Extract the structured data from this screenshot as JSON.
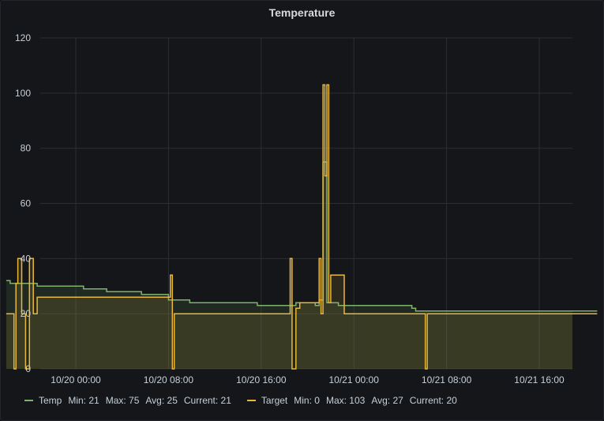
{
  "panel": {
    "title": "Temperature"
  },
  "colors": {
    "temp": "#7eb26d",
    "target": "#eab839",
    "grid": "#2c2e33",
    "text": "#c7d0d9",
    "background": "#141619"
  },
  "legend": [
    {
      "name": "Temp",
      "color_key": "temp",
      "stats": [
        "Min: 21",
        "Max: 75",
        "Avg: 25",
        "Current: 21"
      ]
    },
    {
      "name": "Target",
      "color_key": "target",
      "stats": [
        "Min: 0",
        "Max: 103",
        "Avg: 27",
        "Current: 20"
      ]
    }
  ],
  "chart_data": {
    "type": "area",
    "title": "Temperature",
    "xlabel": "",
    "ylabel": "",
    "ylim": [
      0,
      120
    ],
    "yticks": [
      0,
      20,
      40,
      60,
      80,
      100,
      120
    ],
    "xlim": [
      "10/19 18:00",
      "10/21 21:00"
    ],
    "xticks": [
      "10/20 00:00",
      "10/20 08:00",
      "10/20 16:00",
      "10/21 00:00",
      "10/21 08:00",
      "10/21 16:00"
    ],
    "grid": true,
    "legend_position": "bottom-left",
    "series": [
      {
        "name": "Temp",
        "color": "#7eb26d",
        "fill": true,
        "points": [
          [
            "10/19 18:00",
            32
          ],
          [
            "10/19 18:20",
            31
          ],
          [
            "10/19 19:00",
            31
          ],
          [
            "10/19 20:40",
            30
          ],
          [
            "10/19 22:00",
            30
          ],
          [
            "10/20 00:40",
            29
          ],
          [
            "10/20 02:40",
            28
          ],
          [
            "10/20 05:40",
            27
          ],
          [
            "10/20 08:00",
            25
          ],
          [
            "10/20 09:50",
            24
          ],
          [
            "10/20 15:40",
            23
          ],
          [
            "10/20 19:00",
            24
          ],
          [
            "10/20 20:40",
            23
          ],
          [
            "10/20 21:00",
            25
          ],
          [
            "10/20 21:20",
            75
          ],
          [
            "10/20 21:40",
            24
          ],
          [
            "10/20 22:00",
            24
          ],
          [
            "10/20 22:40",
            23
          ],
          [
            "10/21 05:00",
            22
          ],
          [
            "10/21 05:20",
            21
          ],
          [
            "10/21 21:00",
            21
          ]
        ]
      },
      {
        "name": "Target",
        "color": "#eab839",
        "fill": true,
        "points": [
          [
            "10/19 18:00",
            20
          ],
          [
            "10/19 18:30",
            20
          ],
          [
            "10/19 18:40",
            0
          ],
          [
            "10/19 18:50",
            31
          ],
          [
            "10/19 19:00",
            40
          ],
          [
            "10/19 19:20",
            20
          ],
          [
            "10/19 19:40",
            0
          ],
          [
            "10/19 20:00",
            40
          ],
          [
            "10/19 20:20",
            20
          ],
          [
            "10/19 20:40",
            26
          ],
          [
            "10/20 08:00",
            26
          ],
          [
            "10/20 08:10",
            34
          ],
          [
            "10/20 08:20",
            0
          ],
          [
            "10/20 08:30",
            20
          ],
          [
            "10/20 18:20",
            20
          ],
          [
            "10/20 18:30",
            40
          ],
          [
            "10/20 18:40",
            0
          ],
          [
            "10/20 19:00",
            22
          ],
          [
            "10/20 19:20",
            24
          ],
          [
            "10/20 20:40",
            24
          ],
          [
            "10/20 21:00",
            40
          ],
          [
            "10/20 21:10",
            20
          ],
          [
            "10/20 21:20",
            103
          ],
          [
            "10/20 21:30",
            70
          ],
          [
            "10/20 21:40",
            103
          ],
          [
            "10/20 21:50",
            24
          ],
          [
            "10/20 22:00",
            34
          ],
          [
            "10/20 23:00",
            34
          ],
          [
            "10/20 23:10",
            20
          ],
          [
            "10/21 06:00",
            20
          ],
          [
            "10/21 06:10",
            0
          ],
          [
            "10/21 06:20",
            20
          ],
          [
            "10/21 21:00",
            20
          ]
        ]
      }
    ]
  }
}
